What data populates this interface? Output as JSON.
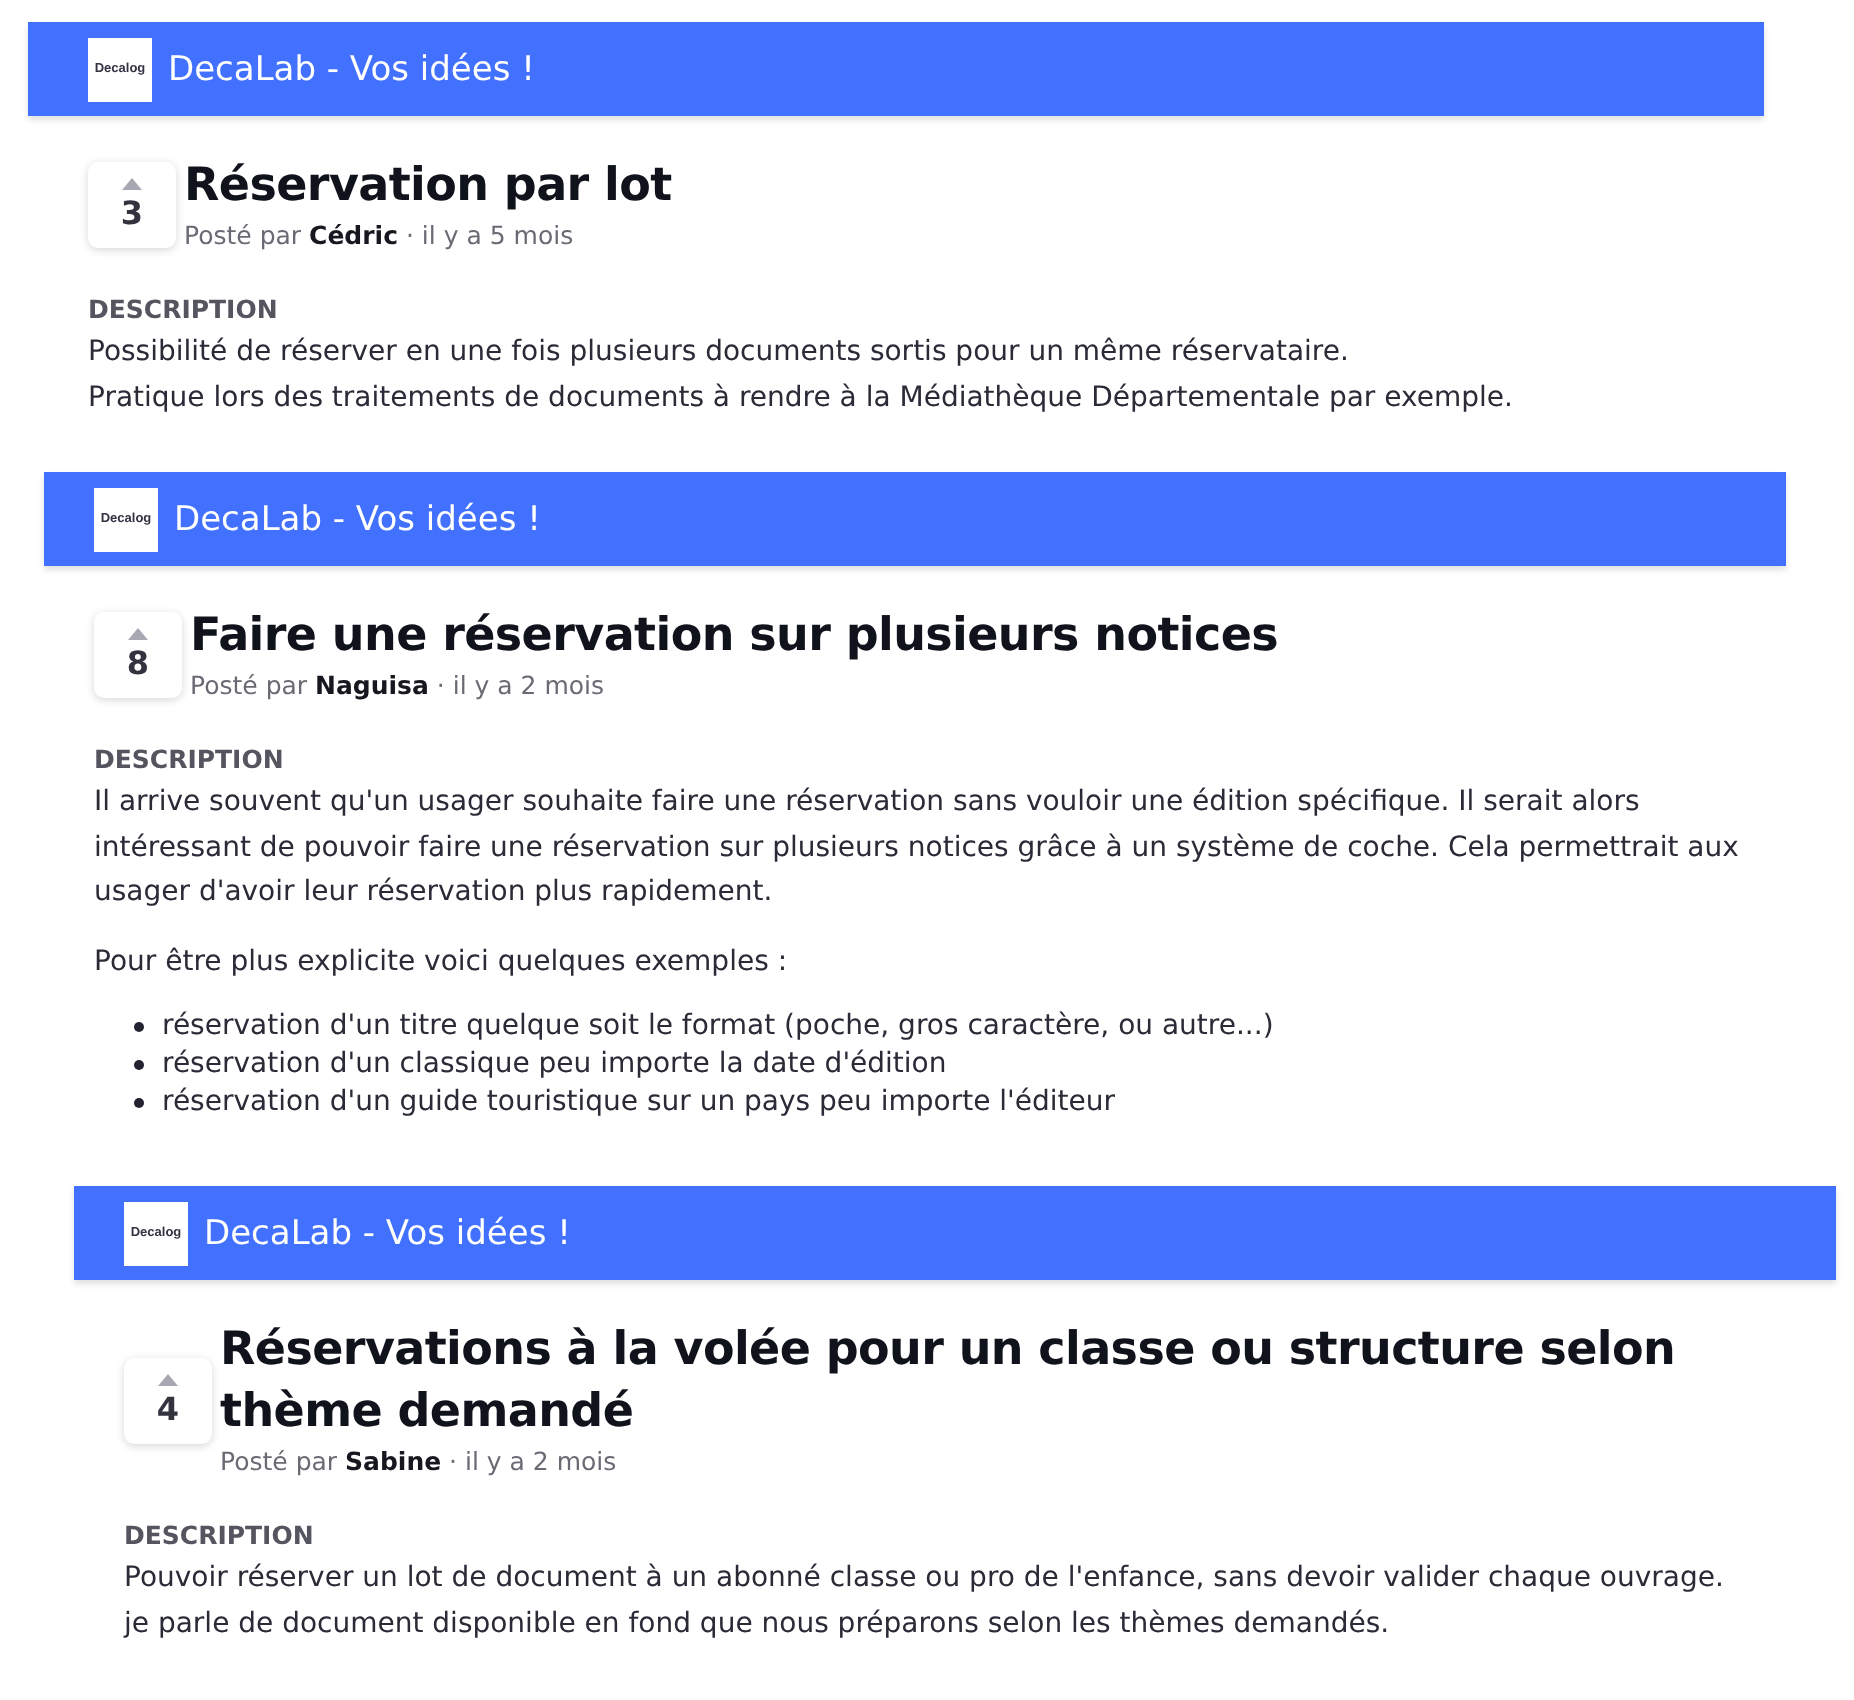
{
  "posts": [
    {
      "header": {
        "logo": "Decalog",
        "title": "DecaLab - Vos idées !"
      },
      "votes": "3",
      "title": "Réservation par lot",
      "meta": "Posté par **Cédric** · il y a 5 mois",
      "description": {
        "label": "DESCRIPTION",
        "blocks": [
          {
            "kind": "paragraph",
            "lines": [
              "Possibilité de réserver en une fois plusieurs documents sortis pour un même réservataire.",
              "Pratique lors des traitements de documents à rendre à la Médiathèque Départementale par exemple."
            ]
          }
        ]
      }
    },
    {
      "header": {
        "logo": "Decalog",
        "title": "DecaLab - Vos idées !"
      },
      "votes": "8",
      "title": "Faire une réservation sur plusieurs notices",
      "meta": "Posté par **Naguisa** · il y a 2 mois",
      "description": {
        "label": "DESCRIPTION",
        "blocks": [
          {
            "kind": "paragraph",
            "lines": [
              "Il arrive souvent qu'un usager souhaite faire une réservation sans vouloir une édition spécifique. Il serait alors intéressant de pouvoir faire une réservation sur plusieurs notices grâce à un système de coche. Cela permettrait aux usager d'avoir leur réservation plus rapidement."
            ]
          },
          {
            "kind": "paragraph",
            "lines": [
              "Pour être plus explicite voici quelques exemples :"
            ]
          },
          {
            "kind": "bullets",
            "items": [
              "réservation d'un titre quelque soit le format (poche, gros caractère, ou autre...)",
              "réservation d'un classique peu importe la date d'édition",
              "réservation d'un guide touristique sur un pays peu importe l'éditeur"
            ]
          }
        ]
      }
    },
    {
      "header": {
        "logo": "Decalog",
        "title": "DecaLab - Vos idées !"
      },
      "votes": "4",
      "title": "Réservations à la volée pour un classe ou structure selon thème demandé",
      "meta": "Posté par **Sabine** · il y a 2 mois",
      "description": {
        "label": "DESCRIPTION",
        "blocks": [
          {
            "kind": "paragraph",
            "lines": [
              "Pouvoir réserver un lot de document à un abonné classe ou pro de l'enfance, sans devoir valider chaque ouvrage.",
              "je parle de document disponible en fond que nous préparons selon les thèmes demandés."
            ]
          }
        ]
      }
    }
  ]
}
